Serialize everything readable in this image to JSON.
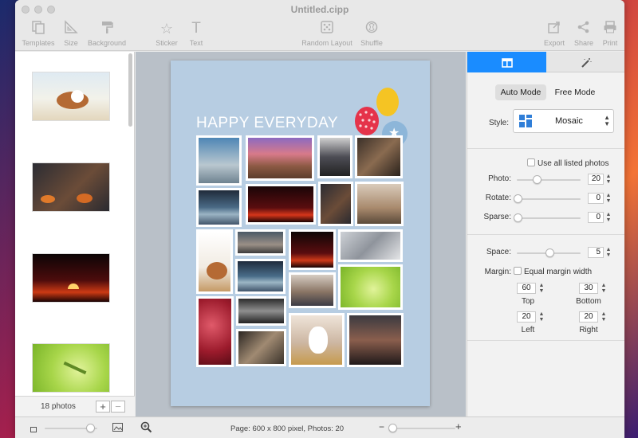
{
  "window": {
    "title": "Untitled.cipp"
  },
  "toolbar": {
    "templates": "Templates",
    "size": "Size",
    "background": "Background",
    "sticker": "Sticker",
    "text": "Text",
    "random_layout": "Random Layout",
    "shuffle": "Shuffle",
    "export": "Export",
    "share": "Share",
    "print": "Print"
  },
  "sidebar": {
    "photo_count": "18 photos",
    "add": "+",
    "remove": "−"
  },
  "canvas": {
    "page_title": "HAPPY EVERYDAY",
    "page_color": "#b7cde2"
  },
  "panel": {
    "mode_auto": "Auto Mode",
    "mode_free": "Free Mode",
    "style_label": "Style:",
    "style_value": "Mosaic",
    "use_all_label": "Use all listed photos",
    "photo_label": "Photo:",
    "photo_value": "20",
    "rotate_label": "Rotate:",
    "rotate_value": "0",
    "sparse_label": "Sparse:",
    "sparse_value": "0",
    "space_label": "Space:",
    "space_value": "5",
    "margin_label": "Margin:",
    "equal_margin_label": "Equal margin width",
    "top_value": "60",
    "bottom_value": "30",
    "left_value": "20",
    "right_value": "20",
    "top_caption": "Top",
    "bottom_caption": "Bottom",
    "left_caption": "Left",
    "right_caption": "Right"
  },
  "status": {
    "text": "Page: 600 x 800 pixel, Photos: 20"
  },
  "colors": {
    "accent": "#1a8cff"
  }
}
